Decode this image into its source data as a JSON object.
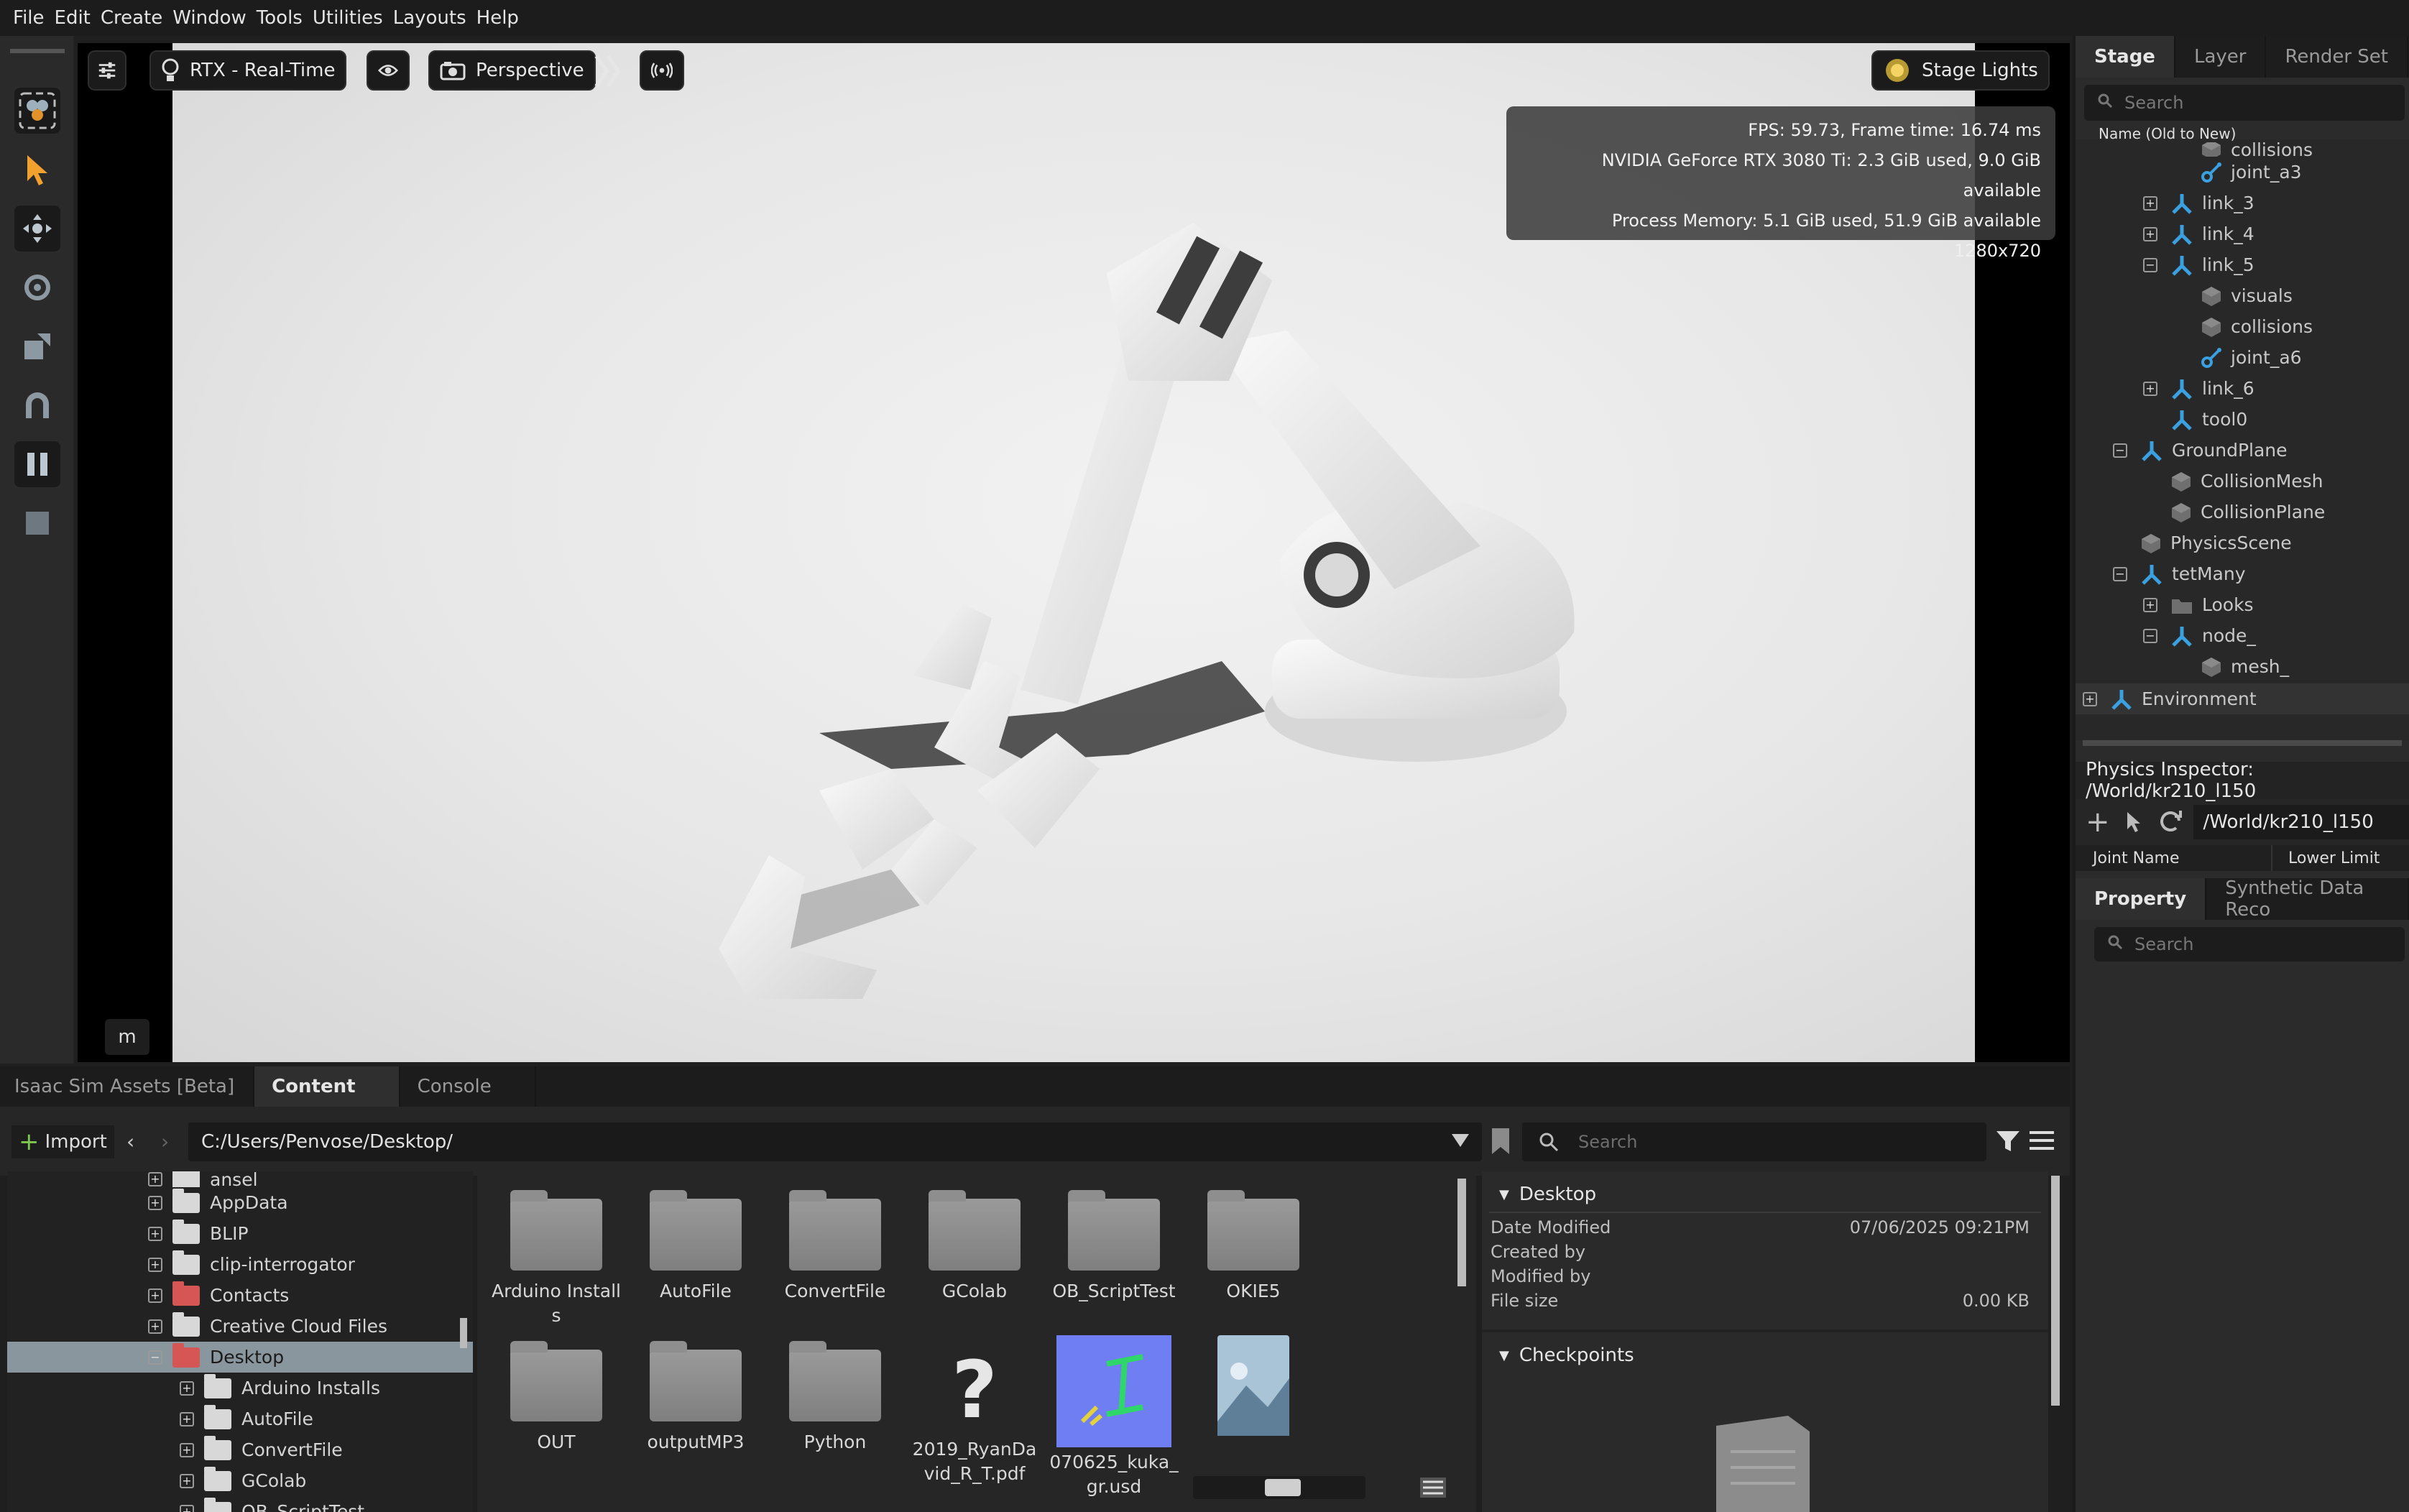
{
  "menu": [
    "File",
    "Edit",
    "Create",
    "Window",
    "Tools",
    "Utilities",
    "Layouts",
    "Help"
  ],
  "viewport": {
    "render_mode": "RTX - Real-Time",
    "camera": "Perspective",
    "lights": "Stage Lights",
    "stats": {
      "fps": "FPS: 59.73, Frame time: 16.74 ms",
      "gpu": "NVIDIA GeForce RTX 3080 Ti: 2.3 GiB used, 9.0 GiB available",
      "memory": "Process Memory: 5.1 GiB used, 51.9 GiB available",
      "resolution": "1280x720"
    },
    "m_label": "m"
  },
  "stage": {
    "tabs": [
      "Stage",
      "Layer",
      "Render Set"
    ],
    "search_placeholder": "Search",
    "column": "Name (Old to New)",
    "items": [
      {
        "label": "collisions",
        "icon": "cube-icon"
      },
      {
        "label": "joint_a3",
        "icon": "joint-icon"
      },
      {
        "label": "link_3",
        "icon": "xform-icon"
      },
      {
        "label": "link_4",
        "icon": "xform-icon"
      },
      {
        "label": "link_5",
        "icon": "xform-icon"
      },
      {
        "label": "visuals",
        "icon": "cube-icon"
      },
      {
        "label": "collisions",
        "icon": "cube-icon"
      },
      {
        "label": "joint_a6",
        "icon": "joint-icon"
      },
      {
        "label": "link_6",
        "icon": "xform-icon"
      },
      {
        "label": "tool0",
        "icon": "xform-icon"
      },
      {
        "label": "GroundPlane",
        "icon": "xform-icon"
      },
      {
        "label": "CollisionMesh",
        "icon": "cube-icon"
      },
      {
        "label": "CollisionPlane",
        "icon": "cube-icon"
      },
      {
        "label": "PhysicsScene",
        "icon": "cube-icon"
      },
      {
        "label": "tetMany",
        "icon": "xform-icon"
      },
      {
        "label": "Looks",
        "icon": "folder-icon"
      },
      {
        "label": "node_",
        "icon": "xform-icon"
      },
      {
        "label": "mesh_",
        "icon": "cube-icon"
      },
      {
        "label": "Environment",
        "icon": "xform-icon"
      }
    ]
  },
  "physics": {
    "title": "Physics Inspector: /World/kr210_l150",
    "path": "/World/kr210_l150",
    "col1": "Joint Name",
    "col2": "Lower Limit"
  },
  "property": {
    "tabs": [
      "Property",
      "Synthetic Data Reco"
    ],
    "search_placeholder": "Search"
  },
  "bottom": {
    "tabs": [
      "Isaac Sim Assets [Beta]",
      "Content",
      "Console"
    ],
    "import_label": "Import",
    "path": "C:/Users/Penvose/Desktop/",
    "search_placeholder": "Search",
    "tree": [
      "ansel",
      "AppData",
      "BLIP",
      "clip-interrogator",
      "Contacts",
      "Creative Cloud Files",
      "Desktop",
      "Arduino Installs",
      "AutoFile",
      "ConvertFile",
      "GColab",
      "OB_ScriptTest"
    ],
    "grid_row1": [
      "Arduino Installs",
      "AutoFile",
      "ConvertFile",
      "GColab",
      "OB_ScriptTest",
      "OKIE5"
    ],
    "grid_row2": [
      "OUT",
      "outputMP3",
      "Python",
      "2019_RyanDavid_R_T.pdf",
      "070625_kuka_gr.usd",
      ""
    ],
    "details": {
      "folder": "Desktop",
      "date_label": "Date Modified",
      "date_value": "07/06/2025 09:21PM",
      "created_label": "Created by",
      "modified_label": "Modified by",
      "size_label": "File size",
      "size_value": "0.00 KB",
      "checkpoints": "Checkpoints"
    }
  }
}
